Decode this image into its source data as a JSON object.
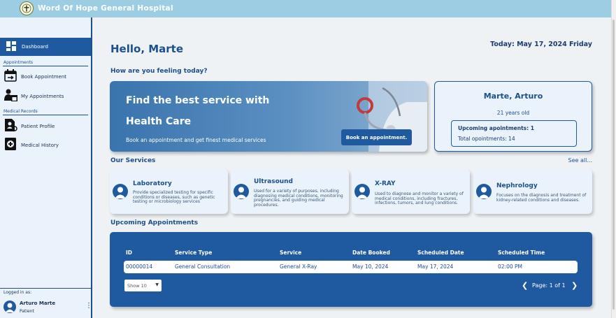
{
  "app": {
    "title": "Word Of Hope General Hospital"
  },
  "sidebar": {
    "dashboard_label": "Dashboard",
    "sections": [
      {
        "heading": "Appointments",
        "items": [
          "Book Appointment",
          "My Appointments"
        ]
      },
      {
        "heading": "Medical Records",
        "items": [
          "Patient Profile",
          "Medical History"
        ]
      }
    ],
    "logged_in_label": "Logged in as:",
    "user_name": "Arturo Marte",
    "user_role": "Patient"
  },
  "main": {
    "greeting": "Hello, Marte",
    "today": "Today: May 17, 2024 Friday",
    "feeling": "How are you feeling today?",
    "banner": {
      "line1": "Find the best service with",
      "line2": "Health Care",
      "subtitle": "Book an appointment and get finest medical services",
      "button": "Book an appointment."
    },
    "profile": {
      "name": "Marte, Arturo",
      "age": "21 years old",
      "upcoming": "Upcoming apointments: 1",
      "total": "Total opointments: 14"
    },
    "services_title": "Our Services",
    "see_all": "See all...",
    "services": [
      {
        "title": "Laboratory",
        "desc": "Provide specialized testing for specific conditions or diseases, such as genetic testing or microbiology services"
      },
      {
        "title": "Ultrasound",
        "desc": "Used for a variety of purposes, including diagnosing medical conditions, monitoring pregnancies, and guiding medical procedures."
      },
      {
        "title": "X-RAY",
        "desc": "Used to diagnose and monitor a variety of medical conditions, including fractures, infections, tumors, and lung conditions."
      },
      {
        "title": "Nephrology",
        "desc": "Focuses on the diagnosis and treatment of kidney-related conditions and diseases."
      }
    ],
    "appointments_title": "Upcoming Appointments",
    "table": {
      "headers": [
        "ID",
        "Service Type",
        "Service",
        "Date Booked",
        "Scheduled Date",
        "Scheduled Time"
      ],
      "rows": [
        [
          "00000014",
          "General Consultation",
          "General X-Ray",
          "May 10, 2024",
          "May 17, 2024",
          "02:00 PM"
        ]
      ]
    },
    "show_select": "Show 10",
    "page_label": "Page: 1 of 1"
  },
  "colors": {
    "primary": "#1f5aa0",
    "topbar": "#9ccde2",
    "card": "#eaf3fb"
  }
}
